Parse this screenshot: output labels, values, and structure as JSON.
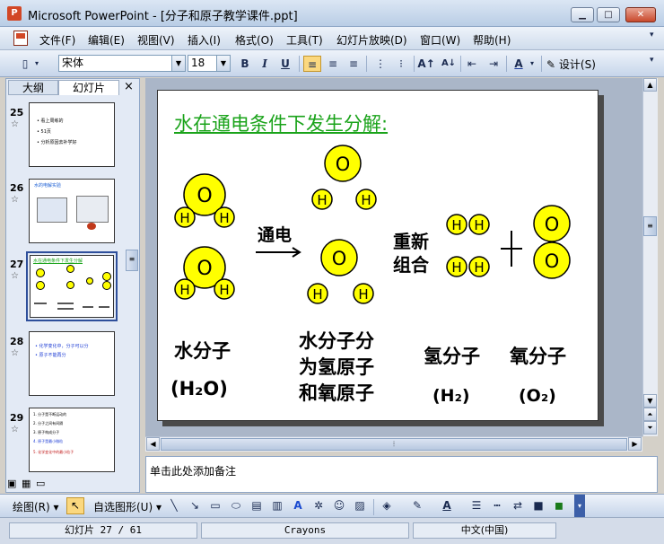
{
  "window": {
    "title": "Microsoft PowerPoint - [分子和原子教学课件.ppt]",
    "app_icon": "P"
  },
  "menu": {
    "items": [
      "文件(F)",
      "编辑(E)",
      "视图(V)",
      "插入(I)",
      "格式(O)",
      "工具(T)",
      "幻灯片放映(D)",
      "窗口(W)",
      "帮助(H)"
    ]
  },
  "toolbar": {
    "font_name": "宋体",
    "font_size": "18",
    "bold": "B",
    "italic": "I",
    "underline": "U",
    "font_color_glyph": "A",
    "design_label": "设计(S)"
  },
  "leftpane": {
    "tabs": [
      "大纲",
      "幻灯片"
    ],
    "close": "×",
    "slides": [
      {
        "num": "25",
        "lines": [
          "• 看上周练的",
          "• 51页",
          "• 分析原因去补学好"
        ]
      },
      {
        "num": "26",
        "caption": "水的电解实验"
      },
      {
        "num": "27",
        "caption": "水在通电条件下发生分解"
      },
      {
        "num": "28",
        "lines": [
          "• 化学变化中，分子可以分",
          "• 原子不能再分"
        ]
      },
      {
        "num": "29",
        "lines": [
          "1. 分子是不断运动的",
          "2. 分子之间有间隔",
          "3. 原子构成分子",
          "4. 原子是最小微粒",
          "5. 化学变化中的最小粒子"
        ]
      }
    ],
    "star": "☆"
  },
  "slide": {
    "title": "水在通电条件下发生分解:",
    "o": "O",
    "h": "H",
    "arrow_label": "通电",
    "regroup_line1": "重新",
    "regroup_line2": "组合",
    "plus": "+",
    "label_water": "水分子",
    "label_water_formula": "(H₂O)",
    "label_split_1": "水分子分",
    "label_split_2": "为氢原子",
    "label_split_3": "和氧原子",
    "label_hydrogen": "氢分子",
    "label_hydrogen_formula": "(H₂)",
    "label_oxygen": "氧分子",
    "label_oxygen_formula": "(O₂)"
  },
  "notes": {
    "placeholder": "单击此处添加备注"
  },
  "drawbar": {
    "draw_label": "绘图(R)",
    "autoshape_label": "自选图形(U)"
  },
  "status": {
    "slide_pos": "幻灯片 27 / 61",
    "design": "Crayons",
    "language": "中文(中国)"
  },
  "colors": {
    "atom_fill": "#ffff00",
    "title_green": "#1aa31a",
    "accent": "#2e4f9b"
  }
}
